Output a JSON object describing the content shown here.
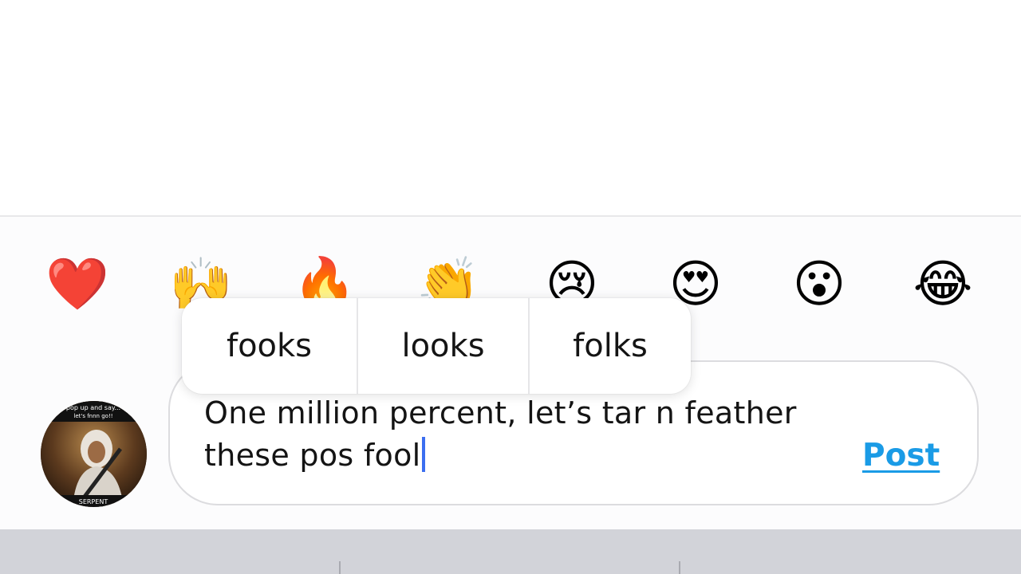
{
  "reactions": [
    {
      "icon": "red-heart",
      "glyph": "❤️"
    },
    {
      "icon": "raising-hands",
      "glyph": "🙌"
    },
    {
      "icon": "fire",
      "glyph": "🔥"
    },
    {
      "icon": "clapping-hands",
      "glyph": "👏"
    },
    {
      "icon": "crying-face",
      "glyph": "😢"
    },
    {
      "icon": "heart-eyes-face",
      "glyph": "😍"
    },
    {
      "icon": "surprised-face",
      "glyph": "😮"
    },
    {
      "icon": "tears-of-joy-face",
      "glyph": "😂"
    }
  ],
  "autocorrect": {
    "suggestions": [
      "fooks",
      "looks",
      "folks"
    ]
  },
  "composer": {
    "text": "One million percent, let’s tar n feather these pos fool",
    "post_label": "Post",
    "post_color": "#1a9be6",
    "caret_color": "#3b6ef0"
  },
  "avatar": {
    "caption_top": "pop up and say... let's fnnn go!!",
    "caption_bottom": "SERPENT"
  }
}
